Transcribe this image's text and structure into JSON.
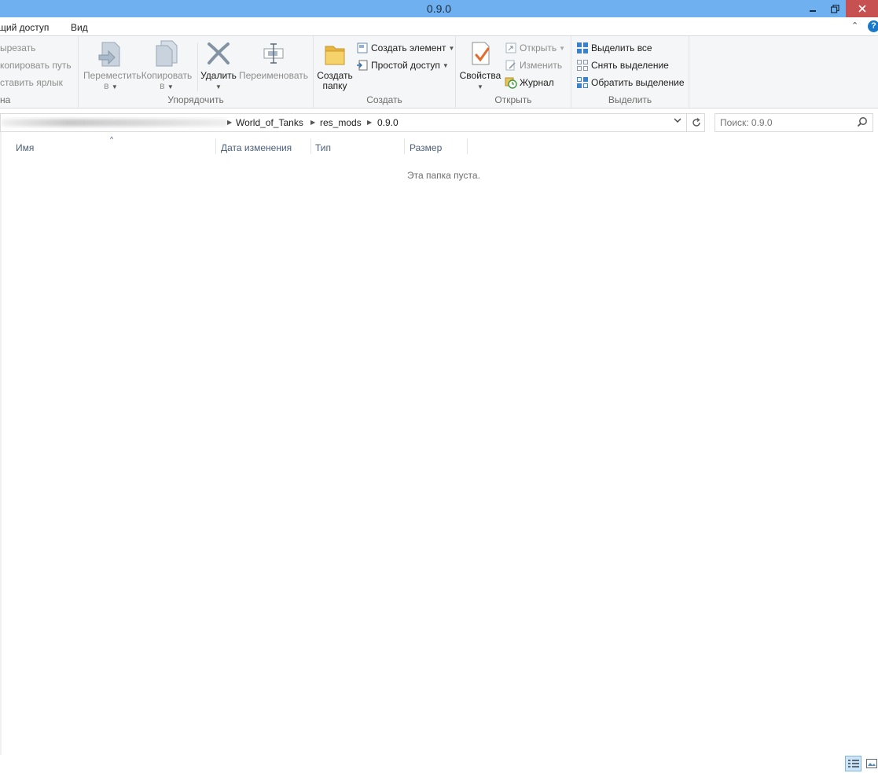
{
  "window": {
    "title": "0.9.0"
  },
  "tabs": {
    "share": "щий доступ",
    "view": "Вид"
  },
  "ribbon": {
    "clipboard": {
      "cut": "ырезать",
      "copy_path": "копировать путь",
      "paste_shortcut": "ставить ярлык",
      "label": "на"
    },
    "organize": {
      "move_to": "Переместить",
      "move_to_2": "в",
      "copy_to": "Копировать",
      "copy_to_2": "в",
      "delete": "Удалить",
      "rename": "Переименовать",
      "label": "Упорядочить"
    },
    "new": {
      "new_folder": "Создать",
      "new_folder_2": "папку",
      "new_item": "Создать элемент",
      "easy_access": "Простой доступ",
      "label": "Создать"
    },
    "open": {
      "properties": "Свойства",
      "open": "Открыть",
      "edit": "Изменить",
      "history": "Журнал",
      "label": "Открыть"
    },
    "select": {
      "select_all": "Выделить все",
      "select_none": "Снять выделение",
      "invert": "Обратить выделение",
      "label": "Выделить"
    }
  },
  "address": {
    "crumbs": [
      "World_of_Tanks",
      "res_mods",
      "0.9.0"
    ]
  },
  "search": {
    "placeholder": "Поиск: 0.9.0"
  },
  "columns": {
    "name": "Имя",
    "date": "Дата изменения",
    "type": "Тип",
    "size": "Размер"
  },
  "content": {
    "empty_message": "Эта папка пуста."
  },
  "colors": {
    "titlebar": "#6eb0f0",
    "close": "#c75050",
    "accent": "#1979ca"
  }
}
